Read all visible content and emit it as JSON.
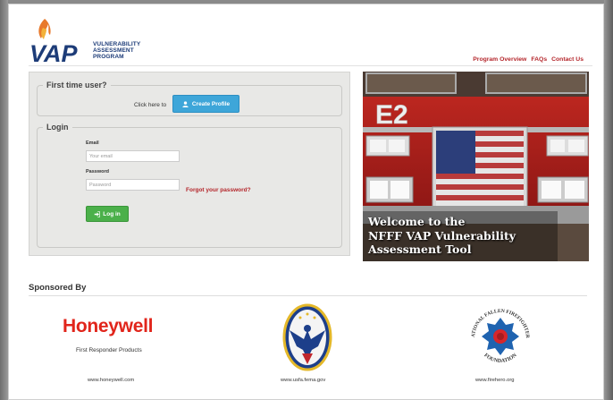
{
  "header": {
    "logo_letters": "VAP",
    "logo_line1": "VULNERABILITY",
    "logo_line2": "ASSESSMENT",
    "logo_line3": "PROGRAM",
    "nav": [
      "Program Overview",
      "FAQs",
      "Contact Us"
    ]
  },
  "first_time": {
    "legend": "First time user?",
    "prompt": "Click here to",
    "create_label": "Create Profile"
  },
  "login": {
    "legend": "Login",
    "email_label": "Email",
    "email_placeholder": "Your email",
    "password_label": "Password",
    "password_placeholder": "Password",
    "forgot_label": "Forgot your password?",
    "login_label": "Log in"
  },
  "hero": {
    "truck_label": "E2",
    "caption_line1": "Welcome to the",
    "caption_line2": "NFFF VAP Vulnerability",
    "caption_line3": "Assessment Tool"
  },
  "sponsors": {
    "heading": "Sponsored By",
    "items": [
      {
        "name": "Honeywell",
        "tagline": "First Responder Products",
        "url": "www.honeywell.com"
      },
      {
        "name": "USFA FEMA",
        "url": "www.usfa.fema.gov"
      },
      {
        "name": "National Fallen Firefighters Foundation",
        "url": "www.firehero.org",
        "logo_top": "NATIONAL FALLEN FIREFIGHTERS",
        "logo_bottom": "FOUNDATION"
      }
    ]
  },
  "colors": {
    "brand_red": "#b4262b",
    "brand_blue": "#1d3c78",
    "create_blue": "#3ea6d9",
    "login_green": "#4bb04a",
    "honeywell_red": "#e1251b"
  },
  "icons": {
    "create": "user-icon",
    "login": "sign-in-icon"
  }
}
